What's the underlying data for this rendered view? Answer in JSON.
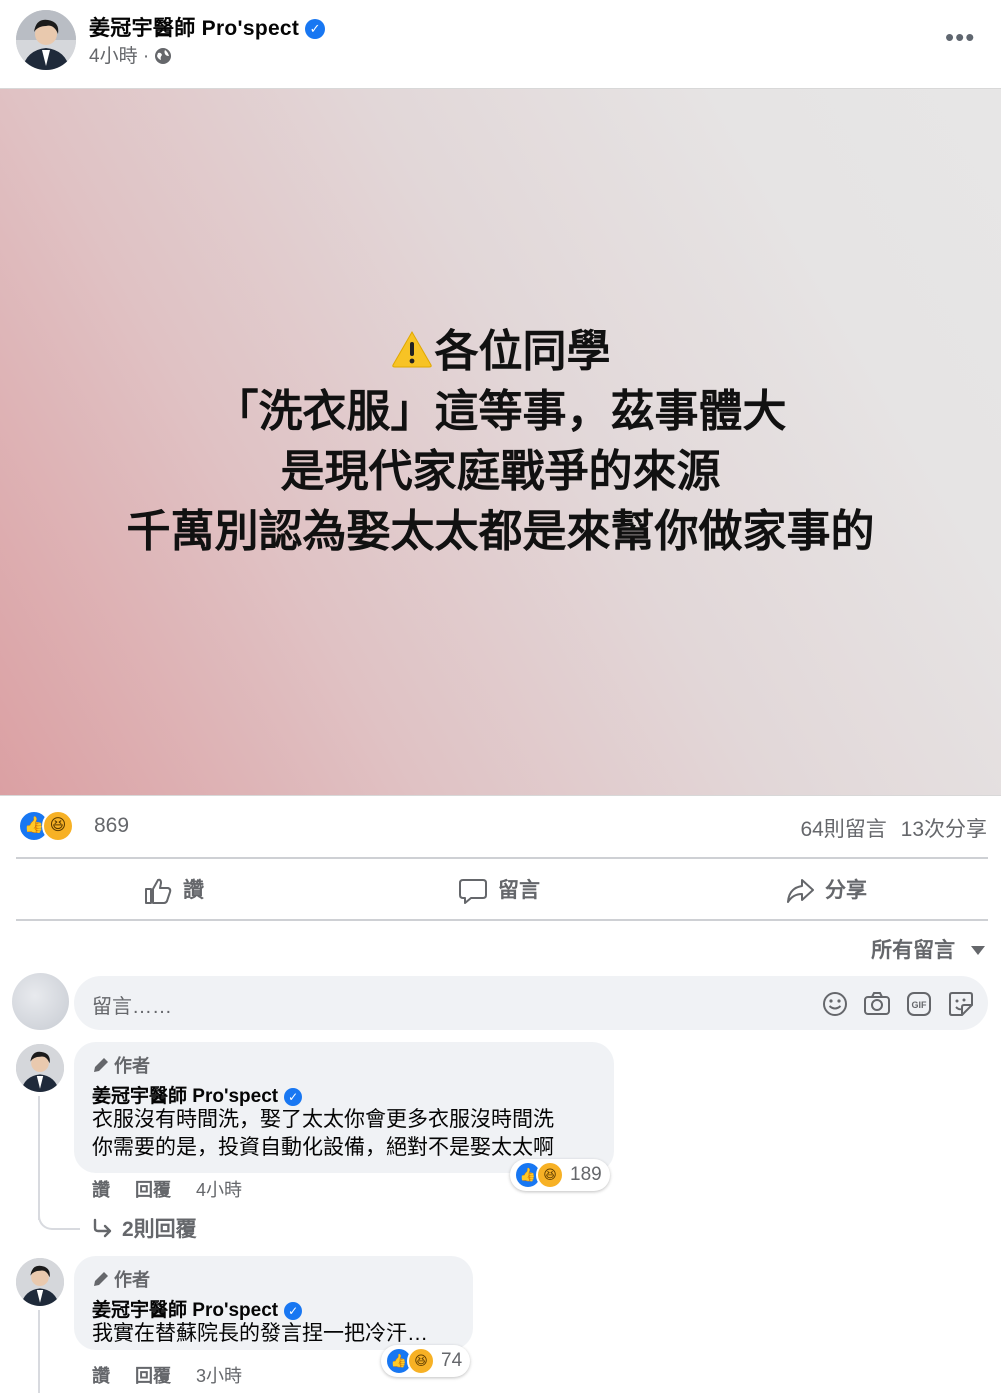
{
  "post": {
    "author": "姜冠宇醫師 Pro'spect",
    "time": "4小時",
    "separator": "·",
    "more_label": "•••",
    "lines": [
      "各位同學",
      "「洗衣服」這等事，茲事體大",
      "是現代家庭戰爭的來源",
      "千萬別認為娶太太都是來幫你做家事的"
    ],
    "warning_icon": "warning-icon"
  },
  "stats": {
    "reactions": "869",
    "comments": "64則留言",
    "shares": "13次分享"
  },
  "actions": {
    "like": "讚",
    "comment": "留言",
    "share": "分享"
  },
  "filter": {
    "label": "所有留言"
  },
  "composer": {
    "placeholder": "留言……"
  },
  "comments": [
    {
      "badge": "作者",
      "name": "姜冠宇醫師 Pro'spect",
      "lines": [
        "衣服沒有時間洗，娶了太太你會更多衣服沒時間洗",
        "你需要的是，投資自動化設備，絕對不是娶太太啊"
      ],
      "reactions": "189",
      "like": "讚",
      "reply": "回覆",
      "time": "4小時",
      "replies": "2則回覆"
    },
    {
      "badge": "作者",
      "name": "姜冠宇醫師 Pro'spect",
      "lines": [
        "我實在替蘇院長的發言捏一把冷汗…"
      ],
      "reactions": "74",
      "like": "讚",
      "reply": "回覆",
      "time": "3小時"
    }
  ],
  "colors": {
    "brand_blue": "#1877f2",
    "haha_yellow": "#f7b125",
    "muted": "#65676b",
    "bubble": "#f0f2f5"
  }
}
